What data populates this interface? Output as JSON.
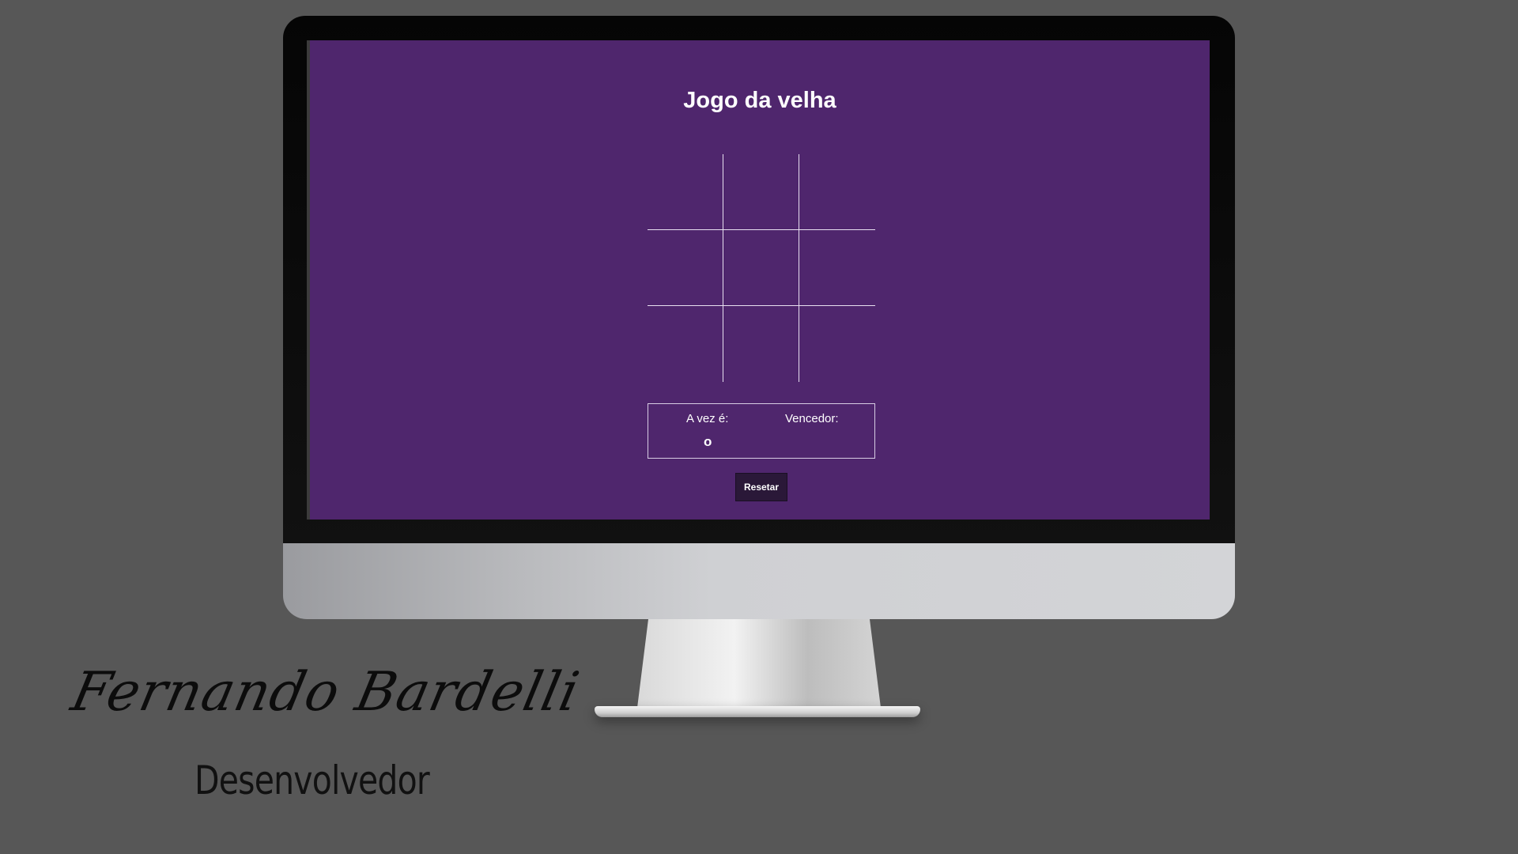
{
  "game": {
    "title": "Jogo da velha",
    "board": [
      [
        "",
        "",
        ""
      ],
      [
        "",
        "",
        ""
      ],
      [
        "",
        "",
        ""
      ]
    ],
    "turn_label": "A vez é:",
    "turn_value": "o",
    "winner_label": "Vencedor:",
    "winner_value": "",
    "reset_label": "Resetar"
  },
  "branding": {
    "signature": "Fernando Bardelli",
    "role": "Desenvolvedor"
  },
  "colors": {
    "background": "#575757",
    "screen": "#4f266d",
    "button": "#2a1838",
    "text": "#ffffff"
  }
}
